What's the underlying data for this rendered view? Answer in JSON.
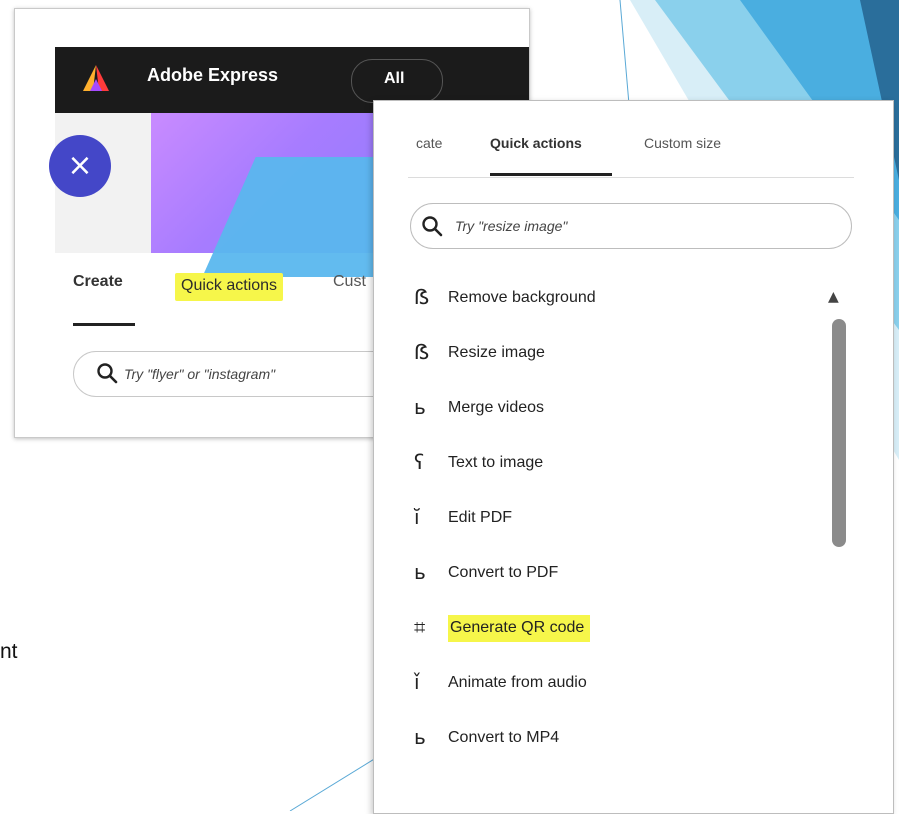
{
  "side_text": "nt",
  "back_card": {
    "brand": "Adobe Express",
    "all_label": "All",
    "close_symbol": "×",
    "tabs": {
      "create": "Create",
      "quick_actions": "Quick actions",
      "custom": "Cust"
    },
    "search_placeholder": "Try \"flyer\" or \"instagram\""
  },
  "panel": {
    "tabs": {
      "tab1": "cate",
      "tab2": "Quick actions",
      "tab3": "Custom size"
    },
    "search_placeholder": "Try \"resize image\"",
    "items": [
      {
        "icon": "ẞ",
        "label": "Remove background",
        "highlight": false
      },
      {
        "icon": "ẞ",
        "label": "Resize image",
        "highlight": false
      },
      {
        "icon": "ь",
        "label": "Merge videos",
        "highlight": false
      },
      {
        "icon": "ʕ",
        "label": "Text to image",
        "highlight": false
      },
      {
        "icon": "ĭ",
        "label": "Edit PDF",
        "highlight": false
      },
      {
        "icon": "ь",
        "label": "Convert to PDF",
        "highlight": false
      },
      {
        "icon": "⌗",
        "label": "Generate QR code",
        "highlight": true
      },
      {
        "icon": "ǐ",
        "label": "Animate from audio",
        "highlight": false
      },
      {
        "icon": "ь",
        "label": "Convert to MP4",
        "highlight": false
      }
    ],
    "scroll_up_symbol": "▲"
  },
  "colors": {
    "highlight": "#f6f64a",
    "close_button": "#4447c8",
    "topbar": "#1b1b1b",
    "accent_blue": "#2f7fb8"
  }
}
